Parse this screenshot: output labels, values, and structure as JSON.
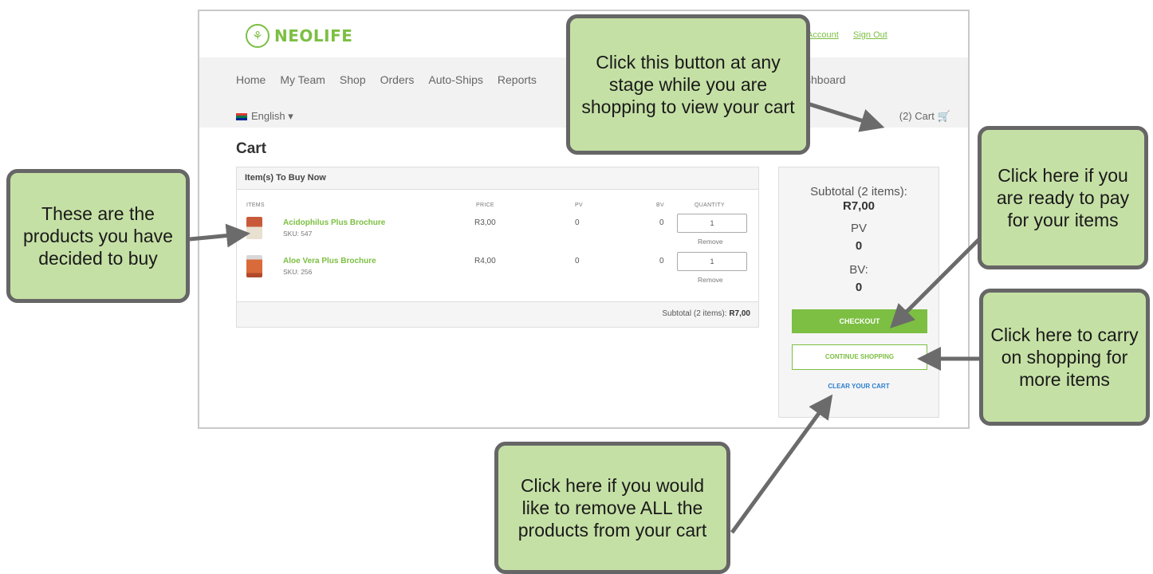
{
  "header": {
    "logo_icon": "wheat-icon",
    "logo_text": "NEOLIFE",
    "account_link": "Account",
    "sign_out_link": "Sign Out"
  },
  "nav": {
    "items": [
      "Home",
      "My Team",
      "Shop",
      "Orders",
      "Auto-Ships",
      "Reports"
    ],
    "dashboard_partial": "shboard",
    "language": "English ▾",
    "cart_link": "(2) Cart",
    "cart_icon": "shopping-cart-icon"
  },
  "page_title": "Cart",
  "items_panel": {
    "heading": "Item(s) To Buy Now",
    "columns": {
      "items": "ITEMS",
      "price": "PRICE",
      "pv": "PV",
      "bv": "BV",
      "quantity": "QUANTITY"
    },
    "rows": [
      {
        "name": "Acidophilus Plus Brochure",
        "sku": "SKU: 547",
        "price": "R3,00",
        "pv": "0",
        "bv": "0",
        "qty": "1",
        "remove": "Remove"
      },
      {
        "name": "Aloe Vera Plus Brochure",
        "sku": "SKU: 256",
        "price": "R4,00",
        "pv": "0",
        "bv": "0",
        "qty": "1",
        "remove": "Remove"
      }
    ],
    "footer_label": "Subtotal (2 items): ",
    "footer_value": "R7,00"
  },
  "summary": {
    "subtotal_label": "Subtotal (2 items):",
    "subtotal_value": "R7,00",
    "pv_label": "PV",
    "pv_value": "0",
    "bv_label": "BV:",
    "bv_value": "0",
    "checkout": "CHECKOUT",
    "continue": "CONTINUE SHOPPING",
    "clear": "CLEAR YOUR CART"
  },
  "callouts": {
    "cart_button": "Click this button at any stage while you are shopping to view your cart",
    "products": "These are the products you have decided to buy",
    "checkout": "Click here if you are ready to pay for your items",
    "continue": "Click here to carry on shopping for more items",
    "clear": "Click here if you would like to remove ALL the products from your cart"
  },
  "colors": {
    "brand_green": "#7cbf42",
    "callout_fill": "#c5e0a5",
    "callout_border": "#666666",
    "link_blue": "#2a7fd1"
  }
}
